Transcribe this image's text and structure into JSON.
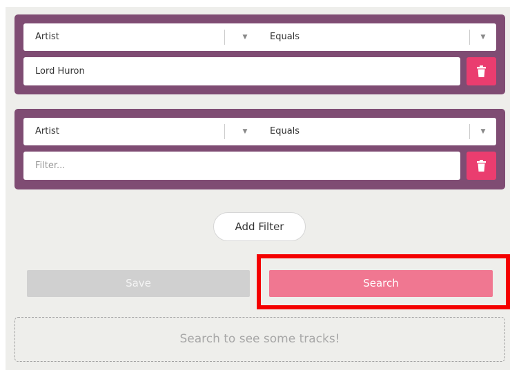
{
  "filters": [
    {
      "field": "Artist",
      "operator": "Equals",
      "value": "Lord Huron",
      "placeholder": "Filter..."
    },
    {
      "field": "Artist",
      "operator": "Equals",
      "value": "",
      "placeholder": "Filter..."
    }
  ],
  "actions": {
    "add_filter": "Add Filter",
    "save": "Save",
    "search": "Search"
  },
  "results": {
    "empty_message": "Search to see some tracks!"
  },
  "icons": {
    "caret": "chevron-down-icon",
    "delete": "trash-icon"
  },
  "colors": {
    "card": "#7f4c73",
    "delete": "#ea3d6f",
    "search": "#f07791",
    "save": "#d0d0d0",
    "background": "#eeeeeb",
    "highlight": "#f40000"
  }
}
